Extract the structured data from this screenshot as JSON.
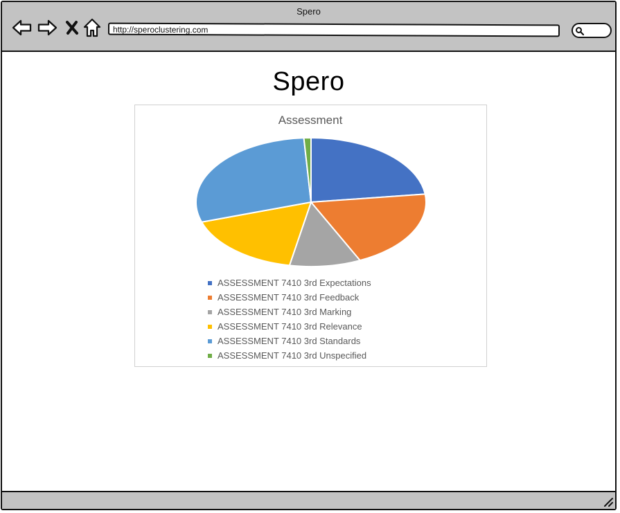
{
  "window": {
    "title": "Spero"
  },
  "toolbar": {
    "url": "http://speroclustering.com"
  },
  "page": {
    "heading": "Spero"
  },
  "chart_data": {
    "type": "pie",
    "title": "Assessment",
    "legend_position": "bottom",
    "slices": [
      {
        "label": "ASSESSMENT 7410 3rd Expectations",
        "value": 23,
        "color": "#4472c4"
      },
      {
        "label": "ASSESSMENT 7410 3rd Feedback",
        "value": 20,
        "color": "#ed7d31"
      },
      {
        "label": "ASSESSMENT 7410 3rd Marking",
        "value": 10,
        "color": "#a5a5a5"
      },
      {
        "label": "ASSESSMENT 7410 3rd Relevance",
        "value": 17,
        "color": "#ffc000"
      },
      {
        "label": "ASSESSMENT 7410 3rd Standards",
        "value": 29,
        "color": "#5b9bd5"
      },
      {
        "label": "ASSESSMENT 7410 3rd Unspecified",
        "value": 1,
        "color": "#70ad47"
      }
    ]
  }
}
